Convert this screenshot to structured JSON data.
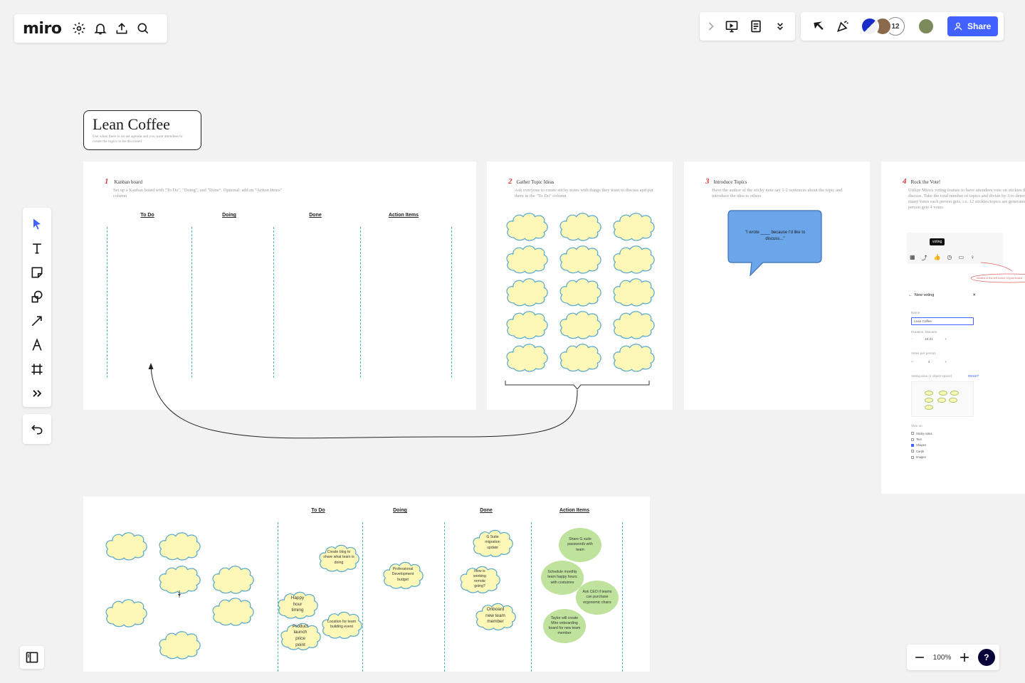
{
  "app": {
    "name": "miro"
  },
  "toolbar_right": {
    "collaborator_count": "12",
    "share_label": "Share"
  },
  "title_card": {
    "title": "Lean Coffee",
    "subtitle": "Use when there is no set agenda and you want attendees to create the topics to be discussed"
  },
  "steps": [
    {
      "num": "1",
      "title": "Kanban board",
      "desc": "Set up a Kanban board with \"To Do\", \"Doing\", and \"Done\". Optional: add an \"Action Items\" column"
    },
    {
      "num": "2",
      "title": "Gather Topic Ideas",
      "desc": "Ask everyone to create sticky notes with things they want to discuss and put them in the \"To Do\" column"
    },
    {
      "num": "3",
      "title": "Introduce Topics",
      "desc": "Have the author of the sticky note say 1-2 sentences about the topic and introduce the idea to others"
    },
    {
      "num": "4",
      "title": "Rock the Vote!",
      "desc": "Utilize Miro's voting feature to have attendees vote on stickies they'd like to discuss. Take the total number of topics and divide by 3 to determine how many votes each person gets. i.e. 12 stickies/topics are generated, so each person gets 4 votes"
    }
  ],
  "kanban_columns": [
    "To Do",
    "Doing",
    "Done",
    "Action Items"
  ],
  "speech_bubble": {
    "text": "\"I wrote ____ because I'd like to discuss...\""
  },
  "voting_panel": {
    "tooltip": "voting",
    "annotation": "located in the left corner of your board",
    "header": "New voting",
    "name_label": "Name",
    "name_value": "Lean Coffee",
    "duration_label": "Duration, Minutes",
    "duration_value": "10:21",
    "votes_label": "Votes per person",
    "votes_value": "4",
    "area_label": "Voting area (1 object space)",
    "area_link": "RESET",
    "vote_on_label": "Vote on",
    "vote_on_options": [
      {
        "label": "Sticky notes",
        "checked": false
      },
      {
        "label": "Text",
        "checked": false
      },
      {
        "label": "Shapes",
        "checked": true
      },
      {
        "label": "Cards",
        "checked": false
      },
      {
        "label": "Images",
        "checked": false
      }
    ]
  },
  "board_example": {
    "todo_notes": [
      "Create blog to share what team is doing",
      "Happy hour timing",
      "Product launch price point",
      "Location for team building event"
    ],
    "doing_notes": [
      "Professional Development budget"
    ],
    "done_notes": [
      "G Suite migration update",
      "How is working remote going?",
      "Onboard new team member"
    ],
    "action_items": [
      "Share G suite passwords with team",
      "Schedule monthly team happy hours with costumes",
      "Ask CEO if teams can purchase ergonomic chairs",
      "Taylor will create Miro onboarding board for new team member"
    ]
  },
  "zoom": {
    "value": "100%"
  },
  "colors": {
    "brand_blue": "#4262ff",
    "sticky_yellow": "#fdf8b7",
    "sticky_border": "#5aa9cc",
    "action_green": "#bfe39d",
    "kanban_dash": "#49b7a6",
    "step_red": "#e03b3b"
  }
}
